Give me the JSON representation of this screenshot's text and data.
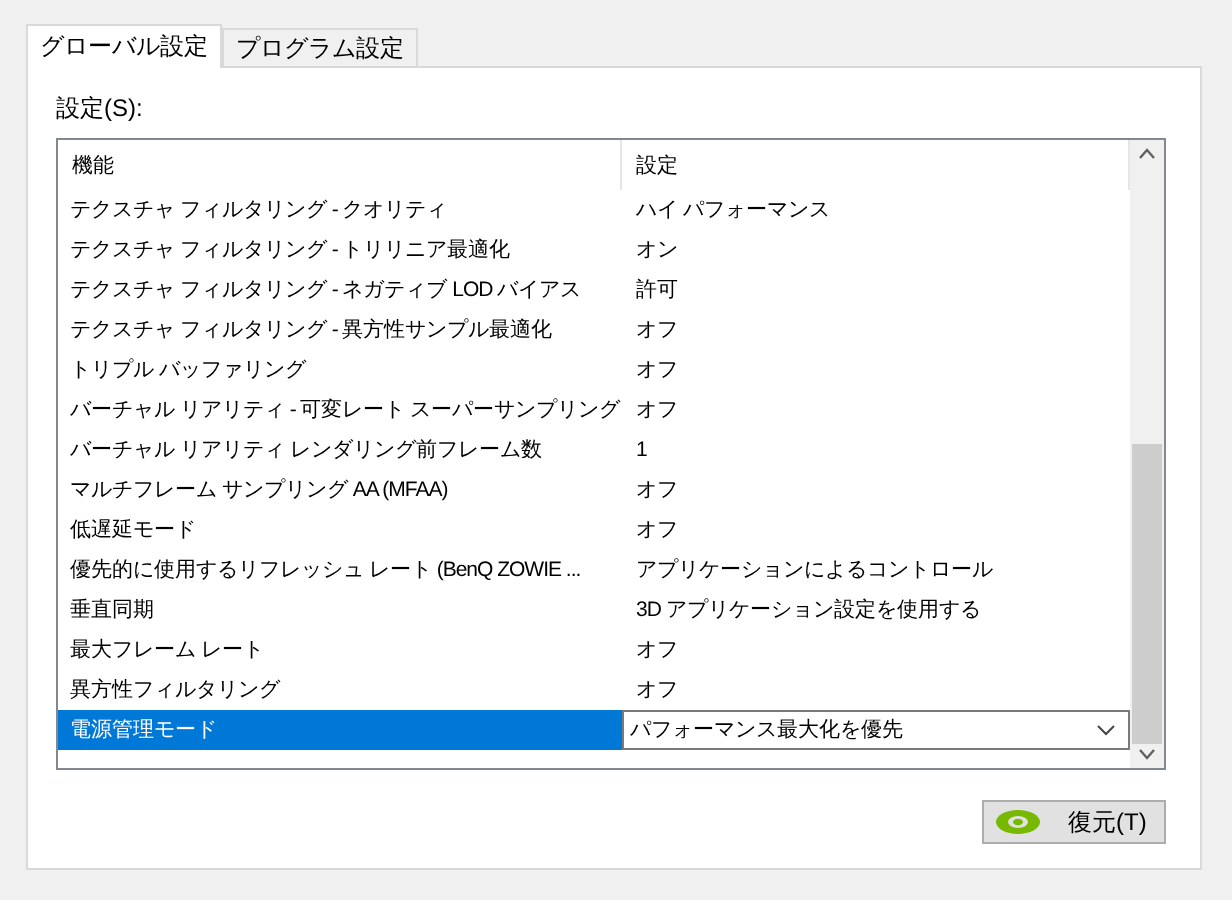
{
  "tabs": [
    {
      "label": "グローバル設定",
      "selected": true
    },
    {
      "label": "プログラム設定",
      "selected": false
    }
  ],
  "settings_label": "設定(S):",
  "table": {
    "columns": [
      "機能",
      "設定"
    ],
    "rows": [
      {
        "feature": "テクスチャ フィルタリング - クオリティ",
        "value": "ハイ パフォーマンス",
        "selected": false
      },
      {
        "feature": "テクスチャ フィルタリング - トリリニア最適化",
        "value": "オン",
        "selected": false
      },
      {
        "feature": "テクスチャ フィルタリング - ネガティブ LOD バイアス",
        "value": "許可",
        "selected": false
      },
      {
        "feature": "テクスチャ フィルタリング - 異方性サンプル最適化",
        "value": "オフ",
        "selected": false
      },
      {
        "feature": "トリプル バッファリング",
        "value": "オフ",
        "selected": false
      },
      {
        "feature": "バーチャル リアリティ - 可変レート スーパーサンプリング",
        "value": "オフ",
        "selected": false
      },
      {
        "feature": "バーチャル リアリティ レンダリング前フレーム数",
        "value": "1",
        "selected": false
      },
      {
        "feature": "マルチフレーム サンプリング AA (MFAA)",
        "value": "オフ",
        "selected": false
      },
      {
        "feature": "低遅延モード",
        "value": "オフ",
        "selected": false
      },
      {
        "feature": "優先的に使用するリフレッシュ レート (BenQ ZOWIE ...",
        "value": "アプリケーションによるコントロール",
        "selected": false
      },
      {
        "feature": "垂直同期",
        "value": "3D アプリケーション設定を使用する",
        "selected": false
      },
      {
        "feature": "最大フレーム レート",
        "value": "オフ",
        "selected": false
      },
      {
        "feature": "異方性フィルタリング",
        "value": "オフ",
        "selected": false
      },
      {
        "feature": "電源管理モード",
        "value": "パフォーマンス最大化を優先",
        "selected": true
      }
    ]
  },
  "restore_button": "復元(T)"
}
